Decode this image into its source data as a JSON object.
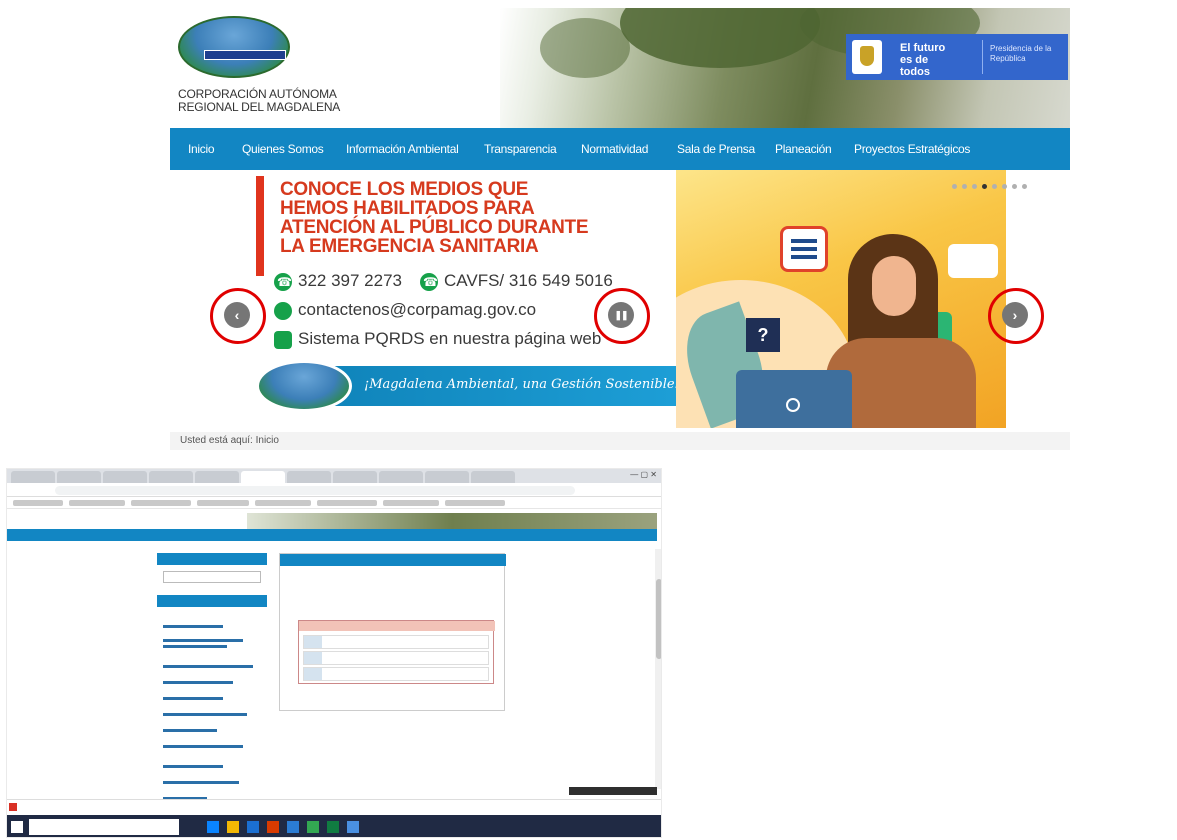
{
  "site": {
    "org_name_line1": "CORPORACIÓN AUTÓNOMA",
    "org_name_line2": "REGIONAL DEL MAGDALENA",
    "gov_slogan": "El futuro es de todos",
    "gov_presidency": "Presidencia de la República"
  },
  "nav": {
    "items": [
      {
        "label": "Inicio"
      },
      {
        "label": "Quienes Somos"
      },
      {
        "label": "Información Ambiental"
      },
      {
        "label": "Transparencia"
      },
      {
        "label": "Normatividad"
      },
      {
        "label": "Sala de Prensa"
      },
      {
        "label": "Planeación"
      },
      {
        "label": "Proyectos Estratégicos"
      }
    ]
  },
  "banner": {
    "headline": [
      "CONOCE LOS MEDIOS QUE",
      "HEMOS HABILITADOS PARA",
      "ATENCIÓN AL PÚBLICO DURANTE",
      "LA  EMERGENCIA SANITARIA"
    ],
    "phone1": "322 397 2273",
    "phone2": "CAVFS/ 316 549 5016",
    "email": "contactenos@corpamag.gov.co",
    "pqrds": "Sistema PQRDS en nuestra página web",
    "slogan": "¡Magdalena Ambiental, una Gestión Sostenible!",
    "question_mark": "?",
    "slide_count": 8,
    "active_slide": 3
  },
  "carousel_controls": {
    "prev_icon": "‹",
    "pause_icon": "❚❚",
    "next_icon": "›",
    "highlight_color": "#e00000"
  },
  "breadcrumb": {
    "text": "Usted está aquí: Inicio"
  },
  "colors": {
    "nav_blue": "#1286c3",
    "headline_red": "#d63a1e",
    "icon_green": "#16a14a"
  }
}
